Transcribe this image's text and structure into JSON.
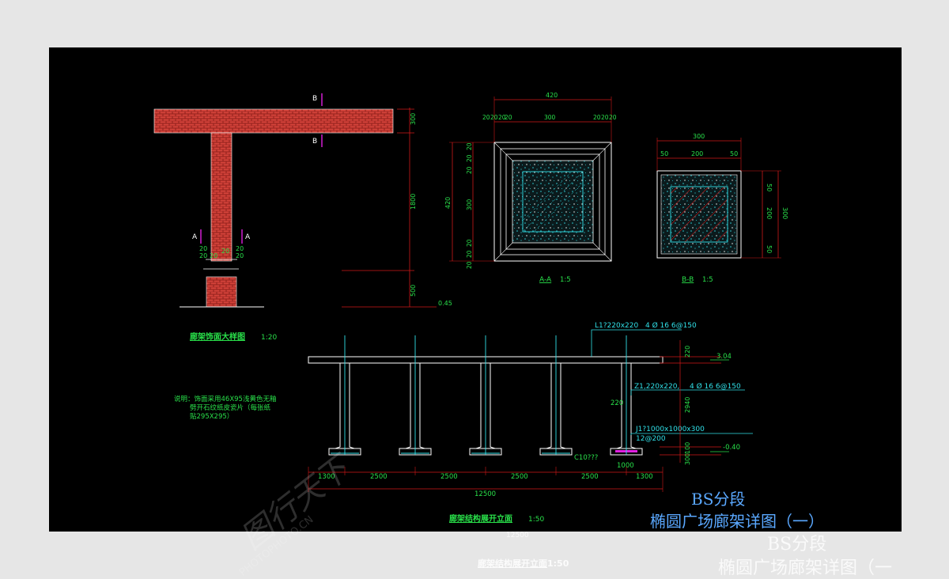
{
  "detail": {
    "title": "廊架饰面大样图",
    "scale": "1:20",
    "section_a": "A",
    "section_b": "B",
    "dims_vertical": [
      "300",
      "1800",
      "500"
    ],
    "dims_small": [
      "20",
      "20",
      "20",
      "20",
      "20",
      "20",
      "20",
      "20"
    ],
    "level": "0.45",
    "note": [
      "说明：饰面采用46X95浅黄色无釉",
      "劈开石纹纸皮瓷片（每张纸",
      "贴295X295）"
    ]
  },
  "section_aa": {
    "title": "A-A",
    "scale": "1:5",
    "dim_top": "420",
    "dims_top_row": [
      "20",
      "20",
      "20",
      "20",
      "300",
      "20",
      "20",
      "20"
    ],
    "dims_left": [
      "20",
      "20",
      "20",
      "420",
      "300",
      "20",
      "20",
      "20"
    ]
  },
  "section_bb": {
    "title": "B-B",
    "scale": "1:5",
    "dim_top": "300",
    "dims_top_row": [
      "50",
      "200",
      "50"
    ],
    "dims_right_inner": [
      "50",
      "200",
      "50"
    ],
    "dim_right_outer": "300"
  },
  "elevation": {
    "title": "廊架结构展开立面",
    "scale": "1:50",
    "beam_label": "L1?220x220",
    "beam_rebar": "4 Ø 16   6@150",
    "column_label": "Z1,220x220,",
    "column_rebar": "4 Ø 16   6@150",
    "col_size": "220",
    "footing_label": "J1?1000x1000x300",
    "footing_rebar": "12@200",
    "concrete": "C10???",
    "footing_width": "1000",
    "level_top": "3.04",
    "level_bottom": "-0.40",
    "dims_right": [
      "220",
      "2940",
      "100",
      "300"
    ],
    "dims_bottom": [
      "1300",
      "2500",
      "2500",
      "2500",
      "2500",
      "1300"
    ],
    "total": "12500"
  },
  "title_block": {
    "line1": "BS分段",
    "line2": "椭圆广场廊架详图（一）"
  },
  "overflow_ghost": {
    "elevation_title": "廊架结构展开立面",
    "elevation_scale": "1:50",
    "number": "12500",
    "line1": "BS分段",
    "line2": "椭圆广场廊架详图（一"
  },
  "watermark": {
    "logo": "图行天下",
    "url": "PHOTOPHOTO.CN"
  },
  "colors": {
    "background": "#000000",
    "brick": "#c8332c",
    "dimension": "#d01818",
    "text_green": "#29e04a",
    "text_cyan": "#30e0e8",
    "text_magenta": "#e020e0",
    "line_white": "#ffffff",
    "title_blue": "#5aa8ff"
  }
}
